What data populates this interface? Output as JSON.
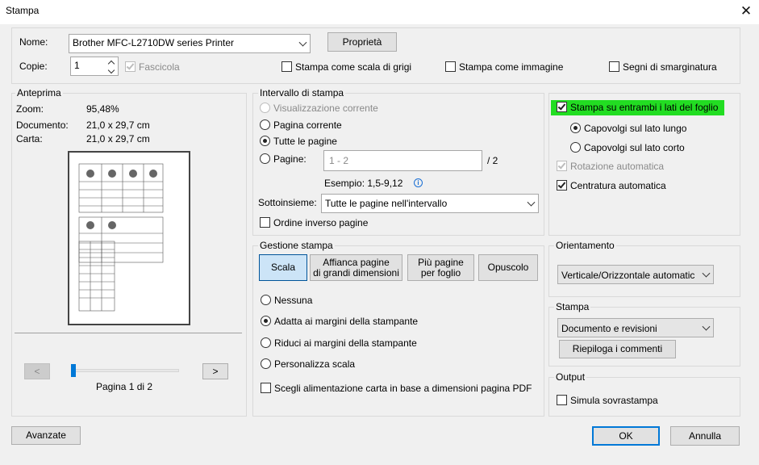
{
  "window": {
    "title": "Stampa"
  },
  "printer": {
    "name_label": "Nome:",
    "selected": "Brother MFC-L2710DW series Printer",
    "properties": "Proprietà",
    "copies_label": "Copie:",
    "copies": "1",
    "collate": "Fascicola",
    "grayscale": "Stampa come scala di grigi",
    "as_image": "Stampa come immagine",
    "crop_marks": "Segni di smarginatura"
  },
  "preview": {
    "title": "Anteprima",
    "zoom_label": "Zoom:",
    "zoom": "95,48%",
    "doc_label": "Documento:",
    "doc": "21,0 x 29,7 cm",
    "paper_label": "Carta:",
    "paper": "21,0 x 29,7 cm",
    "prev": "<",
    "next": ">",
    "page": "Pagina 1 di 2",
    "slider_position": 0.04
  },
  "range": {
    "title": "Intervallo di stampa",
    "current_view": "Visualizzazione corrente",
    "current_page": "Pagina corrente",
    "all_pages": "Tutte le pagine",
    "pages": "Pagine:",
    "pages_placeholder": "1 - 2",
    "total": "/ 2",
    "example": "Esempio: 1,5-9,12",
    "subset_label": "Sottoinsieme:",
    "subset": "Tutte le pagine nell'intervallo",
    "reverse": "Ordine inverso pagine"
  },
  "handling": {
    "title": "Gestione stampa",
    "tabs": [
      {
        "l1": "Scala",
        "l2": ""
      },
      {
        "l1": "Affianca pagine",
        "l2": "di grandi dimensioni"
      },
      {
        "l1": "Più pagine",
        "l2": "per foglio"
      },
      {
        "l1": "Opuscolo",
        "l2": ""
      }
    ],
    "none": "Nessuna",
    "fit": "Adatta ai margini della stampante",
    "shrink": "Riduci ai margini della stampante",
    "custom": "Personalizza scala",
    "paper_source": "Scegli alimentazione carta in base a dimensioni pagina PDF"
  },
  "duplex": {
    "both_sides": "Stampa su entrambi i lati del foglio",
    "long_edge": "Capovolgi sul lato lungo",
    "short_edge": "Capovolgi sul lato corto",
    "auto_rotate": "Rotazione automatica",
    "auto_center": "Centratura automatica",
    "highlight_color": "#22dd22"
  },
  "orientation": {
    "title": "Orientamento",
    "selected": "Verticale/Orizzontale automatic"
  },
  "print": {
    "title": "Stampa",
    "selected": "Documento e revisioni",
    "summarize": "Riepiloga i commenti"
  },
  "output": {
    "title": "Output",
    "simulate": "Simula sovrastampa"
  },
  "footer": {
    "advanced": "Avanzate",
    "ok": "OK",
    "cancel": "Annulla"
  },
  "colors": {
    "accent": "#0078d7",
    "info_icon": "#1a6fd4"
  }
}
